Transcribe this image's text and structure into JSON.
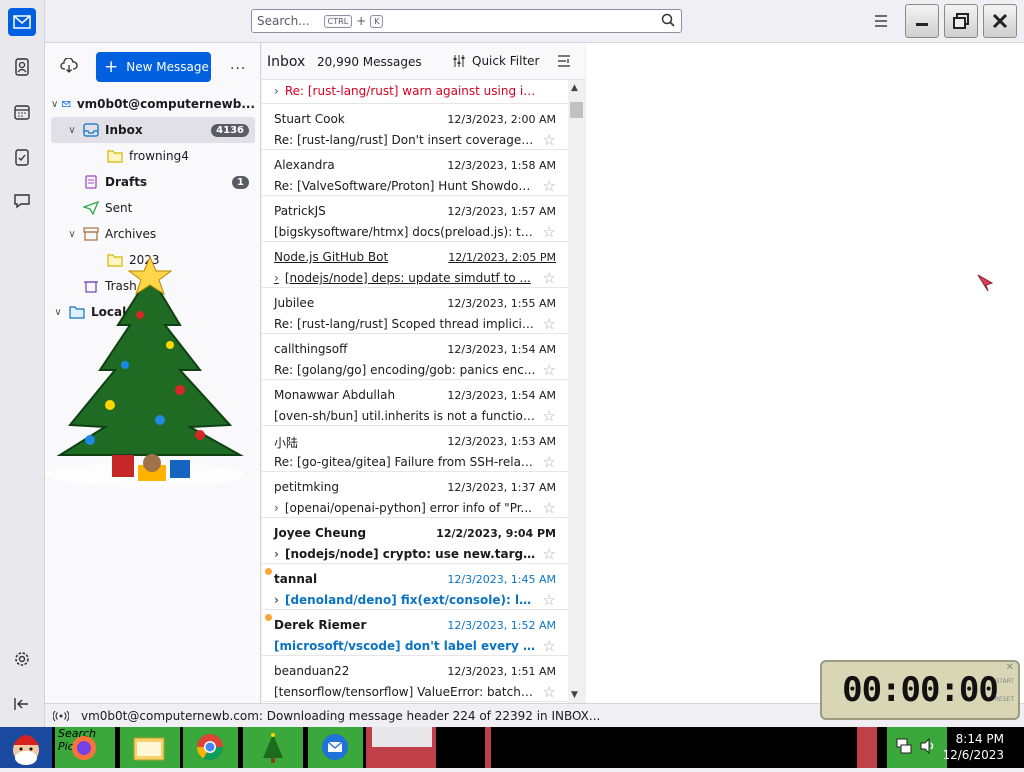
{
  "search": {
    "placeholder": "Search...",
    "key1": "CTRL",
    "plus": "+",
    "key2": "K"
  },
  "folder_pane": {
    "new_message": "New Message",
    "more": "...",
    "account": "vm0b0t@computernewb...",
    "folders": [
      {
        "label": "Inbox",
        "badge": "4136"
      },
      {
        "label": "frowning4"
      },
      {
        "label": "Drafts",
        "badge": "1"
      },
      {
        "label": "Sent"
      },
      {
        "label": "Archives"
      },
      {
        "label": "2023"
      },
      {
        "label": "Trash"
      },
      {
        "label": "Local"
      }
    ]
  },
  "thread_pane": {
    "title": "Inbox",
    "count": "20,990 Messages",
    "quick_filter": "Quick Filter",
    "rows": [
      {
        "subject": "Re: [rust-lang/rust] warn against using int..."
      },
      {
        "from": "Stuart Cook",
        "date": "12/3/2023, 2:00 AM",
        "subject": "Re: [rust-lang/rust] Don't insert coverage c..."
      },
      {
        "from": "Alexandra",
        "date": "12/3/2023, 1:58 AM",
        "subject": "Re: [ValveSoftware/Proton] Hunt Showdow..."
      },
      {
        "from": "PatrickJS",
        "date": "12/3/2023, 1:57 AM",
        "subject": "[bigskysoftware/htmx] docs(preload.js): ty..."
      },
      {
        "from": "Node.js GitHub Bot",
        "date": "12/1/2023, 2:05 PM",
        "subject": "[nodejs/node] deps: update simdutf to ..."
      },
      {
        "from": "Jubilee",
        "date": "12/3/2023, 1:55 AM",
        "subject": "Re: [rust-lang/rust] Scoped thread implicit j..."
      },
      {
        "from": "callthingsoff",
        "date": "12/3/2023, 1:54 AM",
        "subject": "Re: [golang/go] encoding/gob: panics enc..."
      },
      {
        "from": "Monawwar Abdullah",
        "date": "12/3/2023, 1:54 AM",
        "subject": "[oven-sh/bun] util.inherits is not a function ..."
      },
      {
        "from": "小陆",
        "date": "12/3/2023, 1:53 AM",
        "subject": "Re: [go-gitea/gitea] Failure from SSH-relat..."
      },
      {
        "from": "petitmking",
        "date": "12/3/2023, 1:37 AM",
        "subject": "[openai/openai-python] error info of \"Pr..."
      },
      {
        "from": "Joyee Cheung",
        "date": "12/2/2023, 9:04 PM",
        "subject": "[nodejs/node] crypto: use new.target..."
      },
      {
        "from": "tannal",
        "date": "12/3/2023, 1:45 AM",
        "subject": "[denoland/deno] fix(ext/console): lo..."
      },
      {
        "from": "Derek Riemer",
        "date": "12/3/2023, 1:52 AM",
        "subject": "[microsoft/vscode] don't label every sta..."
      },
      {
        "from": "beanduan22",
        "date": "12/3/2023, 1:51 AM",
        "subject": "[tensorflow/tensorflow] ValueError: batch_..."
      }
    ]
  },
  "status": {
    "text": "vm0b0t@computernewb.com: Downloading message header 224 of 22392 in INBOX..."
  },
  "taskbar": {
    "search_text": "Search Pictu",
    "time": "8:14 PM",
    "date": "12/6/2023"
  },
  "timer": {
    "digits": "00:00:00",
    "start": "START",
    "reset": "RESET"
  },
  "colors": {
    "accent": "#0060df",
    "unread_blue": "#0b74c2",
    "red_subject": "#d70022"
  }
}
